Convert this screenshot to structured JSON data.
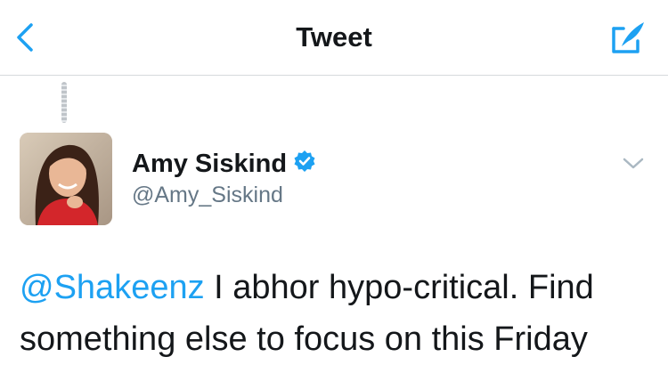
{
  "navbar": {
    "title": "Tweet",
    "back_icon": "chevron-left-icon",
    "compose_icon": "compose-tweet-icon",
    "accent_color": "#1da1f2"
  },
  "tweet": {
    "author": {
      "name": "Amy Siskind",
      "handle": "@Amy_Siskind",
      "verified": true,
      "verified_icon": "verified-badge-icon",
      "avatar_icon": "profile-photo"
    },
    "menu_icon": "chevron-down-icon",
    "mention": "@Shakeenz",
    "text_after_mention": " I abhor hypo-critical.  Find something else to focus on this Friday"
  }
}
